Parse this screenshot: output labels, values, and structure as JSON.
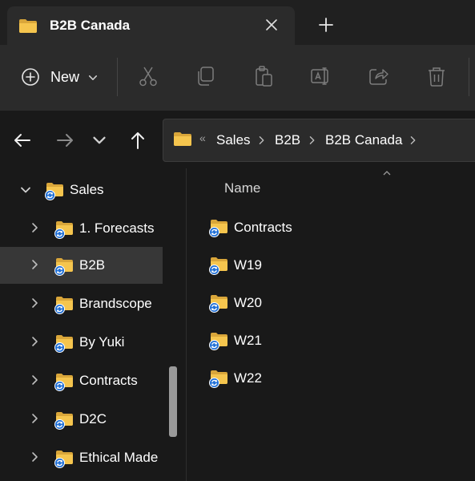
{
  "window": {
    "tab_title": "B2B Canada",
    "tab_icon": "folder-icon"
  },
  "command_bar": {
    "new_label": "New",
    "icons": [
      "cut-icon",
      "copy-icon",
      "paste-icon",
      "rename-icon",
      "share-icon",
      "delete-icon"
    ]
  },
  "address_bar": {
    "overflow": "«",
    "crumbs": [
      "Sales",
      "B2B",
      "B2B Canada"
    ]
  },
  "nav_tree": {
    "items": [
      {
        "label": "Sales",
        "expanded": true,
        "selected": false
      },
      {
        "label": "1. Forecasts",
        "expanded": false,
        "selected": false
      },
      {
        "label": "B2B",
        "expanded": false,
        "selected": true
      },
      {
        "label": "Brandscope",
        "expanded": false,
        "selected": false
      },
      {
        "label": "By Yuki",
        "expanded": false,
        "selected": false
      },
      {
        "label": "Contracts",
        "expanded": false,
        "selected": false
      },
      {
        "label": "D2C",
        "expanded": false,
        "selected": false
      },
      {
        "label": "Ethical Made",
        "expanded": false,
        "selected": false
      }
    ]
  },
  "content": {
    "column_name": "Name",
    "items": [
      "Contracts",
      "W19",
      "W20",
      "W21",
      "W22"
    ]
  },
  "colors": {
    "folder": "#f3c24d",
    "sync_badge": "#1f6fd6",
    "background": "#191919",
    "selected": "#373737"
  }
}
